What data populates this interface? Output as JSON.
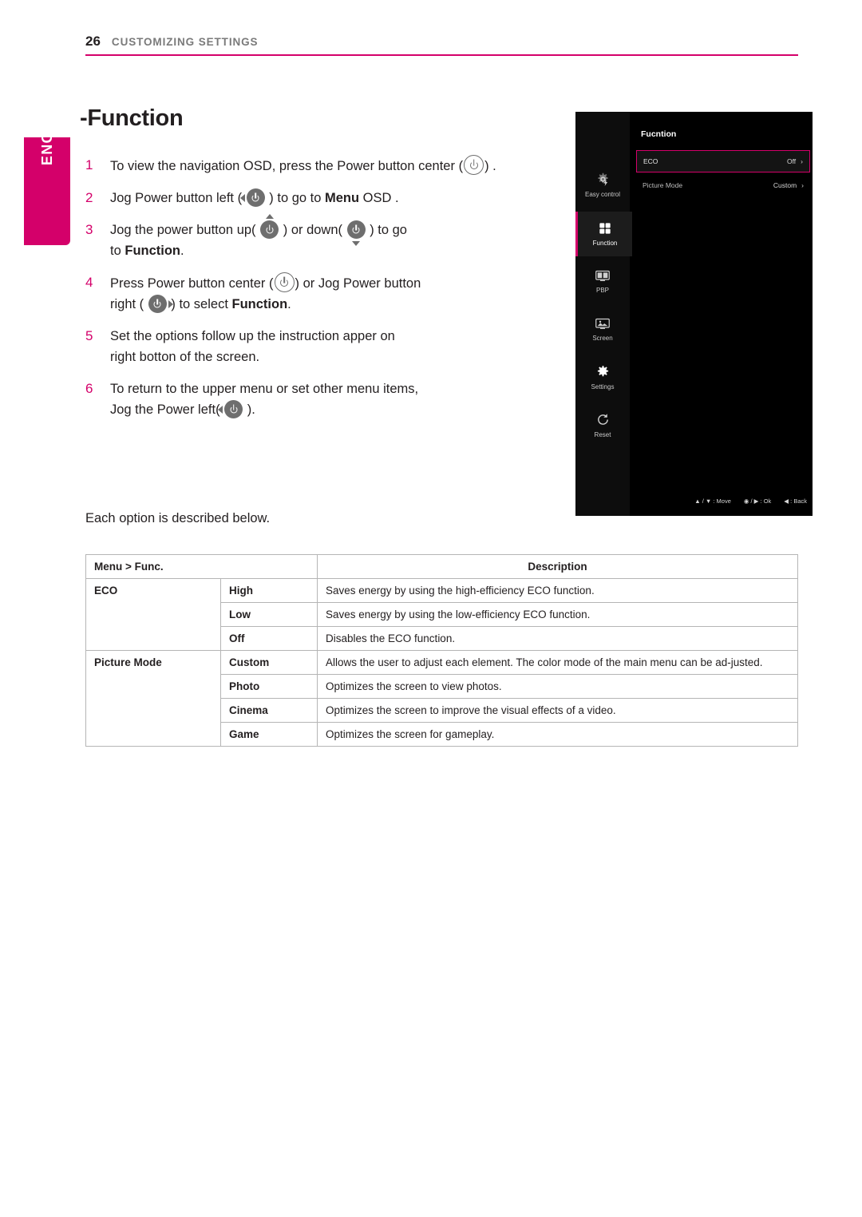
{
  "header": {
    "page_number": "26",
    "title": "CUSTOMIZING SETTINGS"
  },
  "side_tab": {
    "label": "ENGLISH"
  },
  "doc_title": "-Function",
  "steps": [
    {
      "num": "1",
      "html": "To view the navigation OSD, press the Power button center (",
      "tail": ") ."
    },
    {
      "num": "2",
      "html": "Jog Power button left (",
      "tail": ") to go to <b>Menu</b> OSD ."
    },
    {
      "num": "3",
      "html": "Jog the power button up(",
      "tail": ") or down(",
      "tail2": ") to go to <b>Function</b>."
    },
    {
      "num": "4",
      "html": "Press Power button center (",
      "tail": ") or Jog Power button right (",
      "tail2": ") to select <b>Function</b>."
    },
    {
      "num": "5",
      "html": "Set the options follow up the instruction apper on right botton of the screen."
    },
    {
      "num": "6",
      "html": "To return to the upper menu or set other menu items, Jog the Power left(",
      "tail": ")."
    }
  ],
  "step_text": {
    "s1a": "To view the navigation OSD, press the Power button center (",
    "s1b": ") .",
    "s2a": "Jog Power button left (",
    "s2b": ") to go to ",
    "s2bold": "Menu",
    "s2c": " OSD .",
    "s3a": "Jog the power button up(",
    "s3b": ") or down(",
    "s3c": ") to go",
    "s3d": "to ",
    "s3bold": "Function",
    "s3e": ".",
    "s4a": "Press Power button center (",
    "s4b": ") or Jog Power button",
    "s4c": "right (",
    "s4d": ") to select ",
    "s4bold": "Function",
    "s4e": ".",
    "s5a": "Set the options follow up the instruction apper on",
    "s5b": "right botton of the screen.",
    "s6a": "To return to the upper menu or set other menu items,",
    "s6b": "Jog the Power left(",
    "s6c": ")."
  },
  "each_option": "Each option is described below.",
  "osd": {
    "title": "Fucntion",
    "sidebar": [
      {
        "label": "Easy control",
        "icon": "easy-control-icon"
      },
      {
        "label": "Function",
        "icon": "function-icon"
      },
      {
        "label": "PBP",
        "icon": "pbp-icon"
      },
      {
        "label": "Screen",
        "icon": "screen-icon"
      },
      {
        "label": "Settings",
        "icon": "settings-gear-icon"
      },
      {
        "label": "Reset",
        "icon": "reset-icon"
      }
    ],
    "rows": [
      {
        "label": "ECO",
        "value": "Off",
        "selected": true
      },
      {
        "label": "Picture Mode",
        "value": "Custom",
        "selected": false
      }
    ],
    "footer": {
      "move": "▲ / ▼ : Move",
      "ok": "◉ / ▶ : Ok",
      "back": "◀ : Back"
    }
  },
  "table": {
    "headers": {
      "menu": "Menu > Func.",
      "description": "Description"
    },
    "rows": [
      {
        "group": "ECO",
        "option": "High",
        "desc": "Saves energy by using the high-efficiency ECO function."
      },
      {
        "group": "",
        "option": "Low",
        "desc": "Saves energy by using the low-efficiency ECO function."
      },
      {
        "group": "",
        "option": "Off",
        "desc": "Disables the ECO function."
      },
      {
        "group": "Picture Mode",
        "option": "Custom",
        "desc": "Allows the user to adjust each element. The color mode of the main menu can be ad-justed."
      },
      {
        "group": "",
        "option": "Photo",
        "desc": "Optimizes the screen to view photos."
      },
      {
        "group": "",
        "option": "Cinema",
        "desc": "Optimizes the screen to improve the visual effects of a video."
      },
      {
        "group": "",
        "option": "Game",
        "desc": "Optimizes the screen for gameplay."
      }
    ]
  },
  "colors": {
    "accent": "#d4006a",
    "text": "#231f20"
  }
}
